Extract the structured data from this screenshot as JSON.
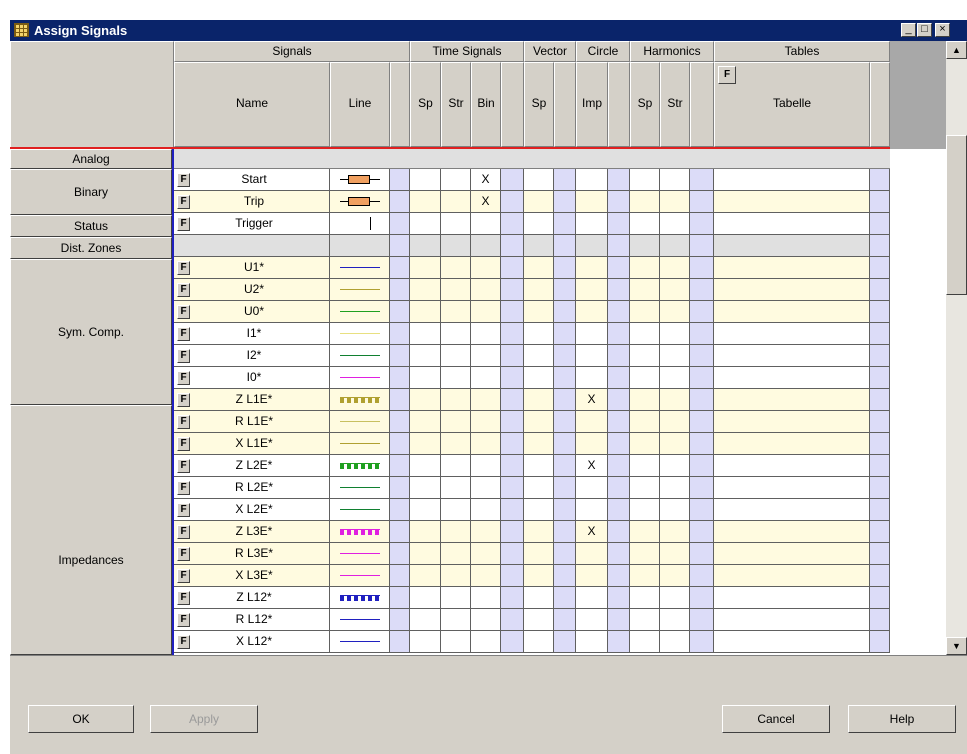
{
  "window": {
    "title": "Assign Signals",
    "controls": [
      "_",
      "□",
      "×"
    ]
  },
  "groups": {
    "signals": "Signals",
    "time_signals": "Time Signals",
    "vector": "Vector",
    "circle": "Circle",
    "harmonics": "Harmonics",
    "tables": "Tables"
  },
  "columns": {
    "name": "Name",
    "line": "Line",
    "ts_sp": "Sp",
    "ts_str": "Str",
    "ts_bin": "Bin",
    "vec_sp": "Sp",
    "circ_imp": "Imp",
    "harm_sp": "Sp",
    "harm_str": "Str",
    "tabelle": "Tabelle",
    "tables_f": "F"
  },
  "row_groups": [
    "Analog",
    "Binary",
    "Status",
    "Dist. Zones",
    "Sym. Comp.",
    "Impedances"
  ],
  "f_label": "F",
  "rows": [
    {
      "name": "Start",
      "line": "bar-orange",
      "color": "#f0a060",
      "bin": "X",
      "imp": "",
      "bg": "#ffffff"
    },
    {
      "name": "Trip",
      "line": "bar-orange",
      "color": "#f0a060",
      "bin": "X",
      "imp": "",
      "bg": "#fffbe0"
    },
    {
      "name": "Trigger",
      "line": "tick",
      "color": "#000000",
      "bin": "",
      "imp": "",
      "bg": "#ffffff"
    },
    {
      "name": "",
      "line": "none",
      "color": "",
      "bin": "",
      "imp": "",
      "bg": "#e0e0e0"
    },
    {
      "name": "U1*",
      "line": "solid",
      "color": "#2020c0",
      "bin": "",
      "imp": "",
      "bg": "#fffbe0"
    },
    {
      "name": "U2*",
      "line": "solid",
      "color": "#b0a030",
      "bin": "",
      "imp": "",
      "bg": "#fffbe0"
    },
    {
      "name": "U0*",
      "line": "solid",
      "color": "#20a020",
      "bin": "",
      "imp": "",
      "bg": "#fffbe0"
    },
    {
      "name": "I1*",
      "line": "solid",
      "color": "#e8e080",
      "bin": "",
      "imp": "",
      "bg": "#ffffff"
    },
    {
      "name": "I2*",
      "line": "solid",
      "color": "#108030",
      "bin": "",
      "imp": "",
      "bg": "#ffffff"
    },
    {
      "name": "I0*",
      "line": "solid",
      "color": "#e020e0",
      "bin": "",
      "imp": "",
      "bg": "#ffffff"
    },
    {
      "name": "Z L1E*",
      "line": "dotted",
      "color": "#b0a030",
      "bin": "",
      "imp": "X",
      "bg": "#fffbe0"
    },
    {
      "name": "R L1E*",
      "line": "solid",
      "color": "#c8c060",
      "bin": "",
      "imp": "",
      "bg": "#fffbe0"
    },
    {
      "name": "X L1E*",
      "line": "solid",
      "color": "#b0a030",
      "bin": "",
      "imp": "",
      "bg": "#fffbe0"
    },
    {
      "name": "Z L2E*",
      "line": "dotted",
      "color": "#20a020",
      "bin": "",
      "imp": "X",
      "bg": "#ffffff"
    },
    {
      "name": "R L2E*",
      "line": "solid",
      "color": "#108030",
      "bin": "",
      "imp": "",
      "bg": "#ffffff"
    },
    {
      "name": "X L2E*",
      "line": "solid",
      "color": "#108030",
      "bin": "",
      "imp": "",
      "bg": "#ffffff"
    },
    {
      "name": "Z L3E*",
      "line": "dotted",
      "color": "#e020e0",
      "bin": "",
      "imp": "X",
      "bg": "#fffbe0"
    },
    {
      "name": "R L3E*",
      "line": "solid",
      "color": "#e020e0",
      "bin": "",
      "imp": "",
      "bg": "#fffbe0"
    },
    {
      "name": "X L3E*",
      "line": "solid",
      "color": "#e020e0",
      "bin": "",
      "imp": "",
      "bg": "#fffbe0"
    },
    {
      "name": "Z L12*",
      "line": "dotted",
      "color": "#2020c0",
      "bin": "",
      "imp": "",
      "bg": "#ffffff"
    },
    {
      "name": "R L12*",
      "line": "solid",
      "color": "#2020c0",
      "bin": "",
      "imp": "",
      "bg": "#ffffff"
    },
    {
      "name": "X L12*",
      "line": "solid",
      "color": "#2020c0",
      "bin": "",
      "imp": "",
      "bg": "#ffffff"
    }
  ],
  "buttons": {
    "ok": "OK",
    "apply": "Apply",
    "cancel": "Cancel",
    "help": "Help"
  },
  "scroll": {
    "up": "▲",
    "down": "▼"
  }
}
